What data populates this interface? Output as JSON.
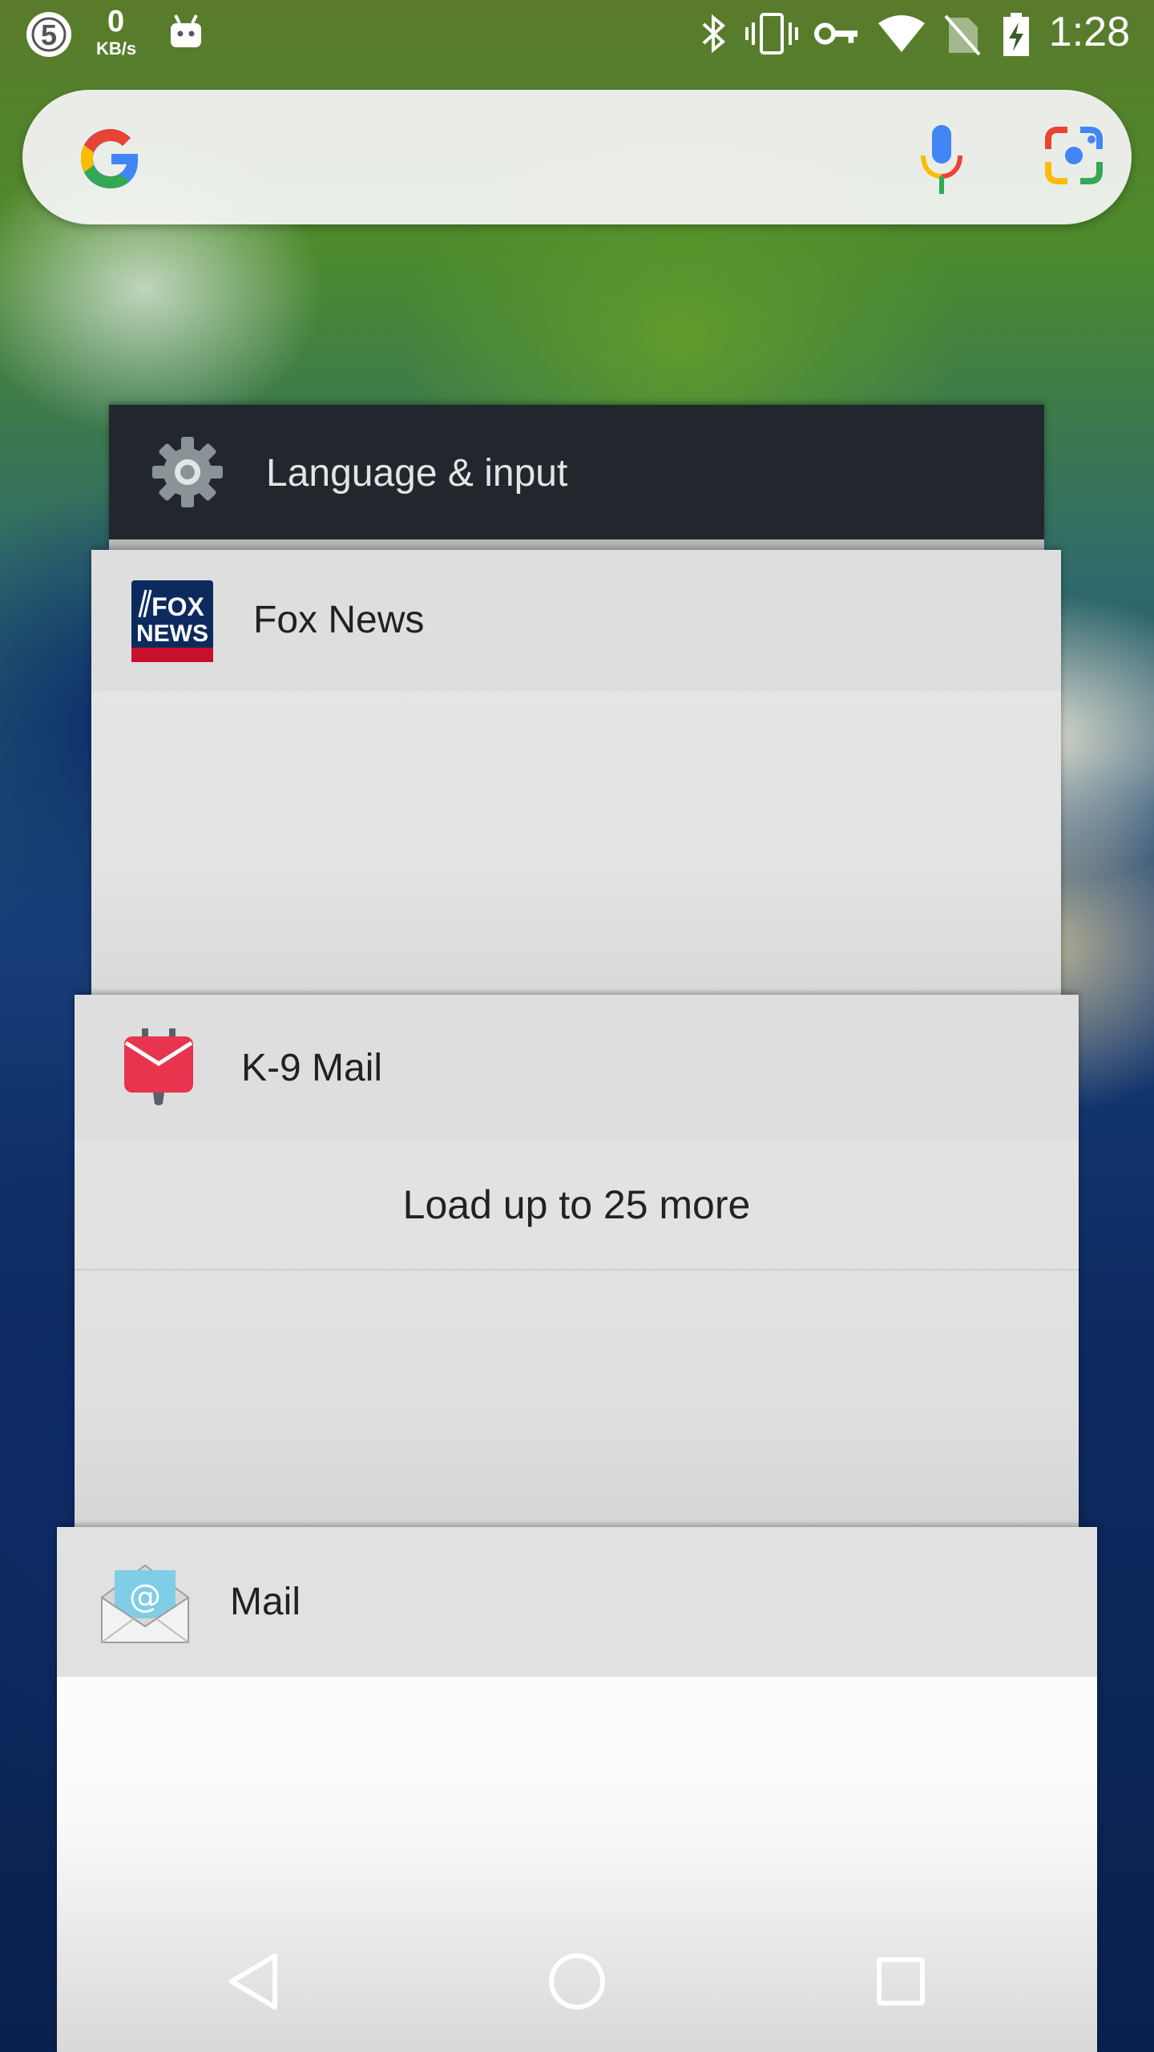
{
  "status_bar": {
    "notification_badge": "5",
    "net_speed_value": "0",
    "net_speed_unit": "KB/s",
    "time": "1:28",
    "icons": [
      "notification-5-icon",
      "android-icon",
      "bluetooth-icon",
      "vibrate-icon",
      "vpn-key-icon",
      "wifi-icon",
      "no-sim-icon",
      "battery-charging-icon"
    ]
  },
  "search": {
    "logo": "google-g-icon",
    "mic_icon": "mic-icon",
    "lens_icon": "lens-icon"
  },
  "recents": {
    "cards": [
      {
        "title": "Language & input",
        "icon": "settings-gear-icon"
      },
      {
        "title": "Fox News",
        "icon": "fox-news-icon",
        "icon_text_1": "FOX",
        "icon_text_2": "NEWS"
      },
      {
        "title": "K-9 Mail",
        "icon": "k9-mail-icon",
        "content": {
          "load_more": "Load up to 25 more"
        }
      },
      {
        "title": "Mail",
        "icon": "email-icon"
      }
    ]
  },
  "nav_bar": {
    "back": "back-icon",
    "home": "home-icon",
    "recents": "recents-icon"
  },
  "colors": {
    "google_blue": "#4285F4",
    "google_red": "#EA4335",
    "google_yellow": "#FBBC05",
    "google_green": "#34A853",
    "k9_red": "#e8344f",
    "fox_blue": "#0d2a5e"
  }
}
